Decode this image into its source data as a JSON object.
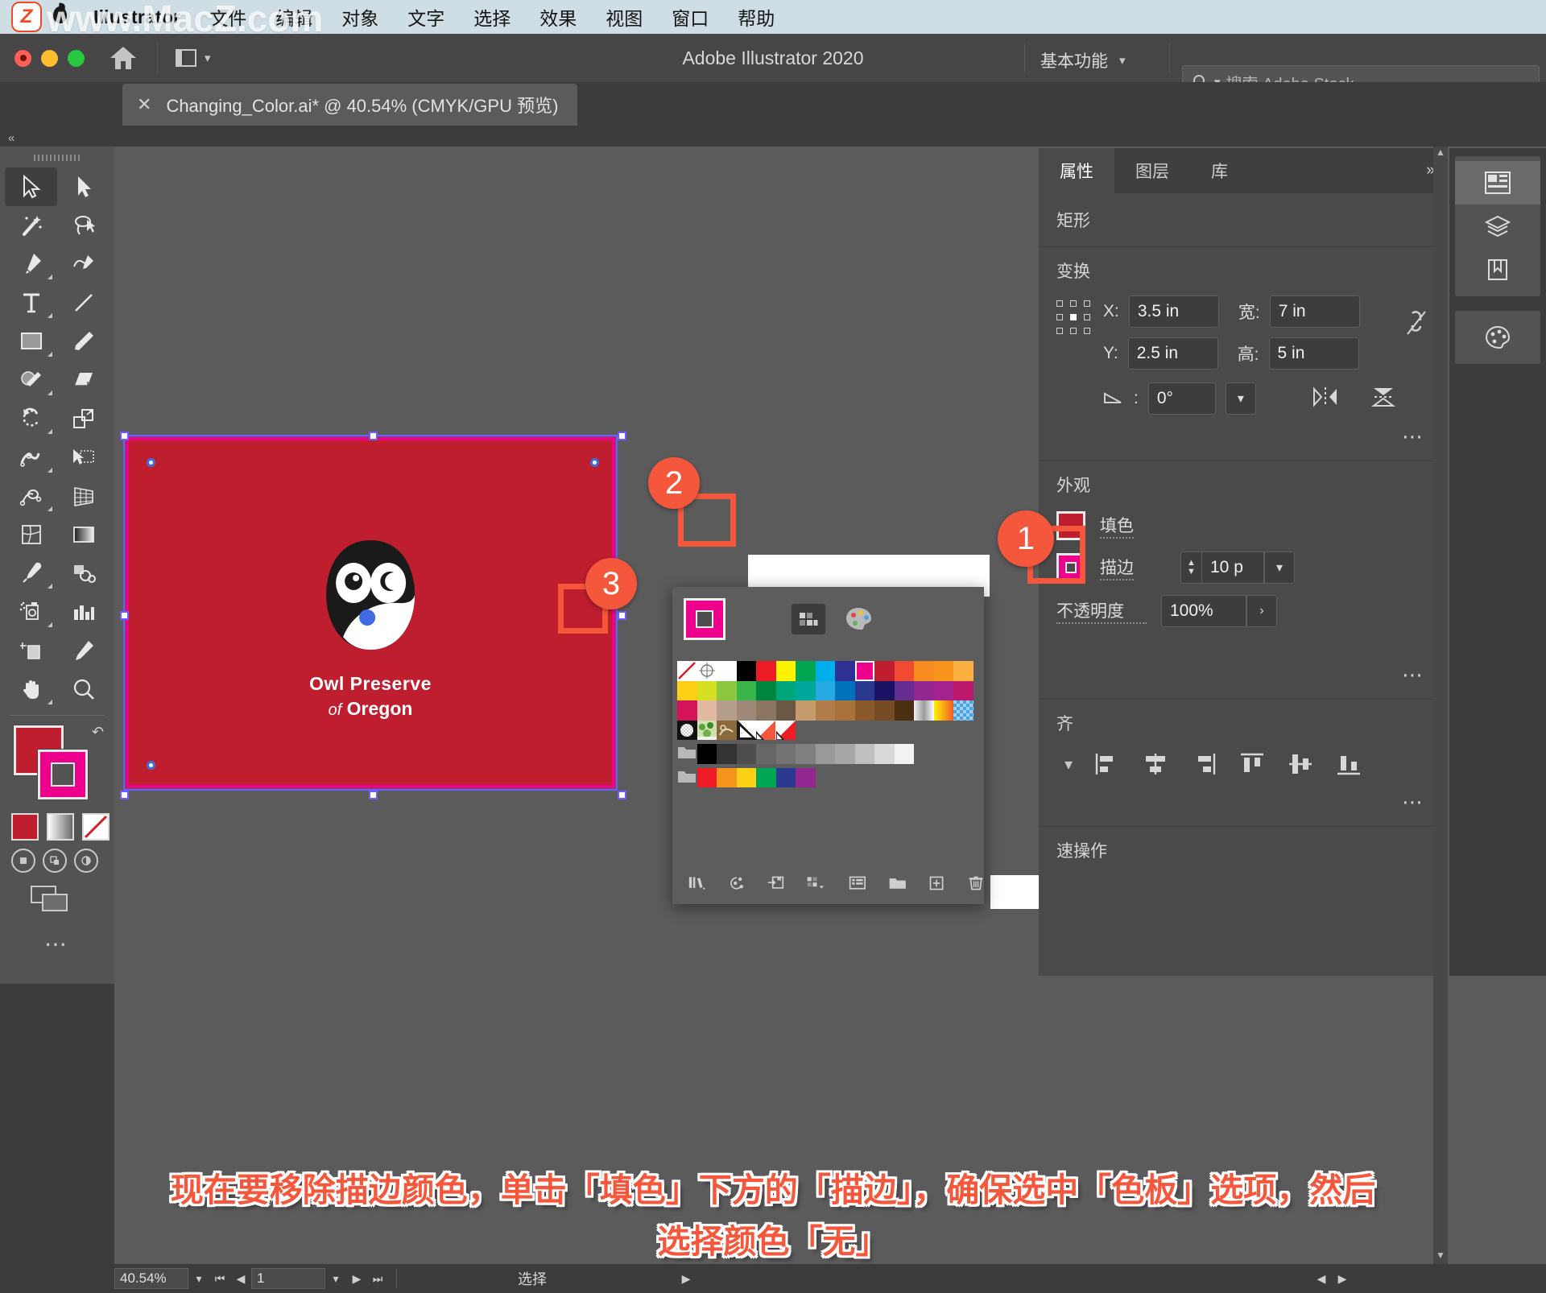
{
  "menubar": {
    "app_name": "Illustrator",
    "items": [
      "文件",
      "编辑",
      "对象",
      "文字",
      "选择",
      "效果",
      "视图",
      "窗口",
      "帮助"
    ],
    "apple_icon": "apple-icon"
  },
  "watermark": {
    "text": "www.MacZ.com",
    "badge": "Z"
  },
  "titlebar": {
    "title": "Adobe Illustrator 2020",
    "home_icon": "home-icon",
    "arrange_icon": "arrange-documents-icon",
    "workspace": "基本功能",
    "workspace_chevron": "chevron-down-icon",
    "search_placeholder": "搜索 Adobe Stock",
    "search_icon": "search-icon",
    "traffic_lights": [
      "close",
      "minimize",
      "zoom"
    ]
  },
  "tabbar": {
    "close_icon": "close-icon",
    "document_title": "Changing_Color.ai* @ 40.54% (CMYK/GPU 预览)"
  },
  "toolbar": {
    "collapse_icon": "double-chevron-left-icon",
    "tools": [
      "selection-tool",
      "direct-selection-tool",
      "magic-wand-tool",
      "lasso-tool",
      "pen-tool",
      "curvature-tool",
      "type-tool",
      "line-segment-tool",
      "rectangle-tool",
      "paintbrush-tool",
      "shape-builder-tool",
      "eraser-tool",
      "rotate-tool",
      "scale-tool",
      "width-tool",
      "free-transform-tool",
      "shape-blend-tool",
      "perspective-grid-tool",
      "mesh-tool",
      "gradient-tool",
      "eyedropper-tool",
      "blend-tool",
      "symbol-sprayer-tool",
      "column-graph-tool",
      "artboard-tool",
      "slice-tool",
      "hand-tool",
      "zoom-tool"
    ],
    "fill_color": "#bf1e2e",
    "stroke_color": "#ec008c",
    "swatch_buttons": [
      "color-swatch",
      "gradient-swatch",
      "none-swatch"
    ],
    "draw_modes": [
      "draw-normal",
      "draw-behind",
      "draw-inside"
    ],
    "screen_mode": "screen-mode-icon",
    "more_tools": "more-tools-icon"
  },
  "artboard": {
    "fill_color": "#bf1e2e",
    "stroke_color": "#ec008c",
    "selection_color": "#6f5cff",
    "logo_title": "Owl Preserve",
    "logo_sub_of": "of",
    "logo_sub_name": "Oregon",
    "owl_body_color": "#1a1a1a",
    "owl_eye_color": "#ffffff",
    "owl_beak_color": "#4169e1"
  },
  "swatches_panel": {
    "fill_stroke_icon": "stroke-indicator",
    "mode_swatches_icon": "swatches-mode-icon",
    "mode_color_icon": "color-mixer-icon",
    "selected_swatch": "#ec008c",
    "none_swatch": "none-swatch",
    "rows": [
      [
        "none",
        "registration",
        "#ffffff",
        "#000000",
        "#ec1c24",
        "#fff200",
        "#00a650",
        "#00aeef",
        "#2e3192",
        "#ec008c",
        "#bf1e2e",
        "#f04a32",
        "#f68b1f",
        "#f7941e",
        "#fbb040"
      ],
      [
        "#d7df23",
        "#8dc63f",
        "#39b54a",
        "#00853f",
        "#00a67c",
        "#00a79d",
        "#27aae1",
        "#0072bc",
        "#2b388f",
        "#1b1464",
        "#662d91",
        "#92278f",
        "#a2238e",
        "#bc1b6d",
        "#c4177c"
      ],
      [
        "#d4145a",
        "#c69c6d",
        "#a67c52",
        "#8c6239",
        "#754c24",
        "#c69c6d",
        "#b07d4a",
        "#a9713c",
        "#8a5a2b",
        "#754c24",
        "#603813",
        "#42210b",
        "gradient-gray",
        "gradient-orange",
        "pattern-blue"
      ],
      [
        "pattern-dots",
        "pattern-leaves",
        "pattern-ornament",
        "bw-corner",
        "orange-corner",
        "red-corner"
      ],
      [
        "folder",
        "#000000",
        "#333333",
        "#4d4d4d",
        "#666666",
        "#737373",
        "#808080",
        "#999999",
        "#a6a6a6",
        "#bfbfbf",
        "#d9d9d9",
        "#f2f2f2"
      ],
      [
        "folder",
        "#ed1c24",
        "#f7941e",
        "#fcd116",
        "#00a651",
        "#2b3990",
        "#92278f"
      ]
    ],
    "toolbar_icons": [
      "swatch-libraries-icon",
      "color-group-link-icon",
      "load-swatches-icon",
      "show-swatch-kinds-icon",
      "swatch-options-icon",
      "new-color-group-icon",
      "new-swatch-icon",
      "delete-swatch-icon"
    ]
  },
  "properties_panel": {
    "tabs": [
      "属性",
      "图层",
      "库"
    ],
    "active_tab": "属性",
    "expand_icon": "double-chevron-right-icon",
    "object_type": "矩形",
    "transform": {
      "title": "变换",
      "reference_point_icon": "reference-point-selector",
      "x_label": "X:",
      "x_value": "3.5 in",
      "y_label": "Y:",
      "y_value": "2.5 in",
      "w_label": "宽:",
      "w_value": "7 in",
      "h_label": "高:",
      "h_value": "5 in",
      "angle_label": "angle-icon",
      "angle_value": "0°",
      "angle_chevron": "chevron-down-icon",
      "constrain_icon": "unlink-proportions-icon",
      "flip_h_icon": "flip-horizontal-icon",
      "flip_v_icon": "flip-vertical-icon",
      "more_icon": "more-options-icon"
    },
    "appearance": {
      "title": "外观",
      "fill_label": "填色",
      "fill_color": "#bf1e2e",
      "stroke_label": "描边",
      "stroke_color": "#ec008c",
      "stroke_weight": "10 p",
      "stroke_stepper_icon": "stepper-icon",
      "stroke_chevron": "chevron-down-icon",
      "opacity_label": "不透明度",
      "opacity_value": "100%",
      "opacity_chevron": "chevron-right-icon",
      "more_icon": "more-options-icon"
    },
    "align": {
      "title_partial": "齐",
      "chevron": "chevron-down-icon",
      "icons": [
        "align-left-icon",
        "align-center-h-icon",
        "align-right-icon",
        "align-top-icon",
        "align-center-v-icon",
        "align-bottom-icon"
      ],
      "more_icon": "more-options-icon"
    },
    "quick_actions": {
      "title": "速操作"
    }
  },
  "icon_rail": {
    "buttons": [
      "properties-panel-icon",
      "layers-panel-icon",
      "libraries-panel-icon",
      "color-guide-icon"
    ]
  },
  "callouts": [
    {
      "number": "1",
      "target": "stroke-swatch-in-properties"
    },
    {
      "number": "2",
      "target": "swatches-mode-button"
    },
    {
      "number": "3",
      "target": "none-swatch"
    }
  ],
  "caption": {
    "line1": "现在要移除描边颜色，单击「填色」下方的「描边」，确保选中「色板」选项，然后",
    "line2": "选择颜色「无」",
    "color": "#f4573b"
  },
  "statusbar": {
    "zoom_value": "40.54%",
    "zoom_chevron": "chevron-down-icon",
    "first_page_icon": "first-page-icon",
    "prev_page_icon": "prev-page-icon",
    "page_value": "1",
    "page_chevron": "chevron-down-icon",
    "next_page_icon": "next-page-icon",
    "last_page_icon": "last-page-icon",
    "status_text": "选择",
    "nav_arrow_icon": "nav-arrow-icon",
    "scroll_left_icon": "scroll-left-icon",
    "scroll_right_icon": "scroll-right-icon"
  }
}
